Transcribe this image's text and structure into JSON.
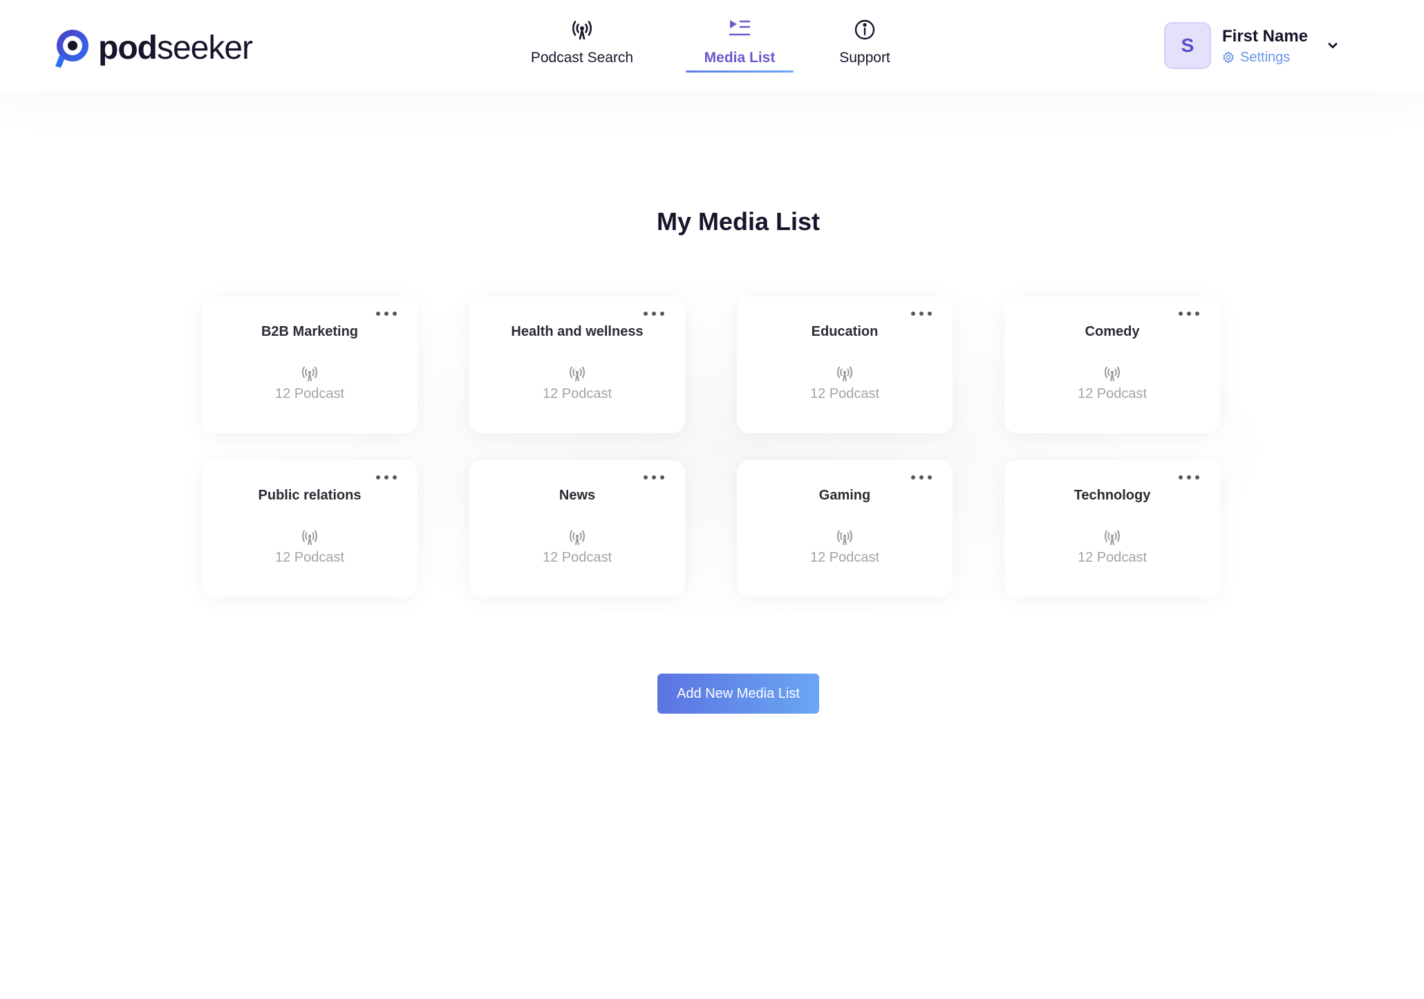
{
  "brand": {
    "pod": "pod",
    "seeker": "seeker",
    "primary_color": "#15152b",
    "accent_color": "#6a5acd"
  },
  "nav": {
    "items": [
      {
        "label": "Podcast Search",
        "icon": "podcast-broadcast-icon"
      },
      {
        "label": "Media List",
        "icon": "media-list-icon",
        "active": true
      },
      {
        "label": "Support",
        "icon": "info-icon"
      }
    ]
  },
  "user": {
    "initial": "S",
    "name": "First Name",
    "settings_label": "Settings"
  },
  "page": {
    "title": "My Media List"
  },
  "media_lists": [
    {
      "title": "B2B Marketing",
      "count": "12 Podcast"
    },
    {
      "title": "Health and wellness",
      "count": "12 Podcast"
    },
    {
      "title": "Education",
      "count": "12 Podcast"
    },
    {
      "title": "Comedy",
      "count": "12 Podcast"
    },
    {
      "title": "Public relations",
      "count": "12 Podcast"
    },
    {
      "title": "News",
      "count": "12 Podcast"
    },
    {
      "title": "Gaming",
      "count": "12 Podcast"
    },
    {
      "title": "Technology",
      "count": "12 Podcast"
    }
  ],
  "actions": {
    "add_label": "Add New Media List"
  }
}
